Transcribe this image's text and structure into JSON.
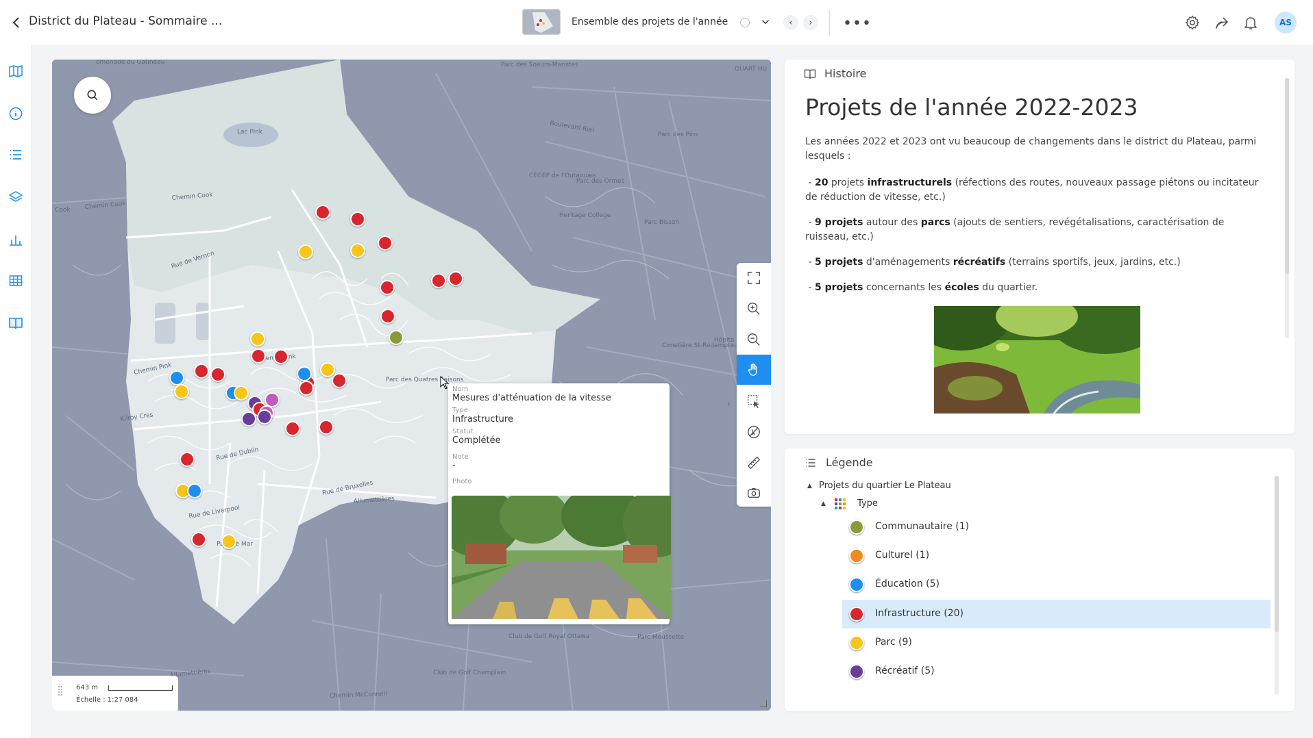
{
  "header": {
    "title": "District du Plateau - Sommaire ...",
    "map_name": "Ensemble des projets de l'année",
    "avatar_initials": "AS"
  },
  "sidebar": {
    "icons": [
      "map-icon",
      "info-icon",
      "list-icon",
      "layers-icon",
      "chart-icon",
      "table-icon",
      "story-book-icon"
    ]
  },
  "map": {
    "labels": {
      "lac_pink": "Lac Pink",
      "chemin_cook": "Chemin Cook",
      "chemin_cook2": "Chemin Cook",
      "cook_short": "Cook",
      "rue_de_vernon": "Rue de Vernon",
      "chemin_pink": "Chemin Pink",
      "chemin_pink2": "Chemin Pink",
      "kilroy": "Kilroy Cres",
      "rue_de_dublin": "Rue de Dublin",
      "rue_de_bruxelles": "Rue de Bruxelles",
      "rue_de_liverpool": "Rue de Liverpool",
      "allumettieres": "Allumettières",
      "allumettieres2": "Allumettières",
      "allumettieres3": "Allumettières",
      "parc_quatres": "Parc des Quatres Saisons",
      "parc_soeurs": "Parc des Soeurs-Maristes",
      "cegep": "CÉGEP de l'Outaouais",
      "parc_ormes": "Parc des Ormes",
      "parc_pins": "Parc des Pins",
      "parc_bisson": "Parc Bisson",
      "heritage": "Heritage College",
      "cimetiere": "Cimetière St-Rédempteur",
      "hopital": "Hôpita",
      "golf_ottawa": "Club de Golf Royal Ottawa",
      "golf_champlain": "Club de Golf Champlain",
      "parc_moussette": "Parc Moussette",
      "chemin_mcconnell": "Chemin McConnell",
      "boulevard_riel": "Boulevard Riel",
      "parc_marie": "Parc de Mar",
      "quartier": "QUARTIER DU VIEUX-TEMPLE",
      "monnaie_top": "omenade du Gatineau",
      "quart_hu": "QUART HU"
    },
    "scale": {
      "distance": "643 m",
      "ratio": "Échelle : 1:27 084"
    },
    "markers_colors": {
      "infrastructure": "#d7262e",
      "parc": "#f5c518",
      "education": "#1e8ff0",
      "recreatif": "#6a3d9a",
      "communautaire": "#8a9a3a",
      "culturel": "#f08a1e",
      "rose": "#c05cbf"
    }
  },
  "popup": {
    "nom_label": "Nom",
    "nom_value": "Mesures d'atténuation de la vitesse",
    "type_label": "Type",
    "type_value": "Infrastructure",
    "statut_label": "Statut",
    "statut_value": "Complétée",
    "note_label": "Note",
    "note_value": "-",
    "photo_label": "Photo"
  },
  "story": {
    "header": "Histoire",
    "title": "Projets de l'année 2022-2023",
    "intro": "Les années 2022 et 2023 ont vu beaucoup de changements dans le district du Plateau, parmi lesquels :",
    "item1_num": "20",
    "item1_pre": " projets ",
    "item1_bold": "infrastructurels",
    "item1_rest": " (réfections des routes, nouveaux passage piétons ou incitateur de réduction de vitesse, etc.)",
    "item2_bold": "9 projets",
    "item2_mid": " autour des ",
    "item2_bold2": "parcs",
    "item2_rest": " (ajouts de sentiers, revégétalisations, caractérisation de ruisseau, etc.)",
    "item3_bold": "5 projets",
    "item3_mid": " d'aménagements ",
    "item3_bold2": "récréatifs",
    "item3_rest": " (terrains sportifs, jeux, jardins, etc.)",
    "item4_bold": "5 projets",
    "item4_mid": " concernants les ",
    "item4_bold2": "écoles",
    "item4_rest": " du quartier."
  },
  "legend": {
    "header": "Légende",
    "group": "Projets du quartier Le Plateau",
    "sub": "Type",
    "items": [
      {
        "label": "Communautaire (1)",
        "color": "#8a9a3a"
      },
      {
        "label": "Culturel (1)",
        "color": "#f08a1e"
      },
      {
        "label": "Éducation (5)",
        "color": "#1e8ff0"
      },
      {
        "label": "Infrastructure (20)",
        "color": "#d7262e"
      },
      {
        "label": "Parc (9)",
        "color": "#f5c518"
      },
      {
        "label": "Récréatif (5)",
        "color": "#6a3d9a"
      }
    ]
  }
}
